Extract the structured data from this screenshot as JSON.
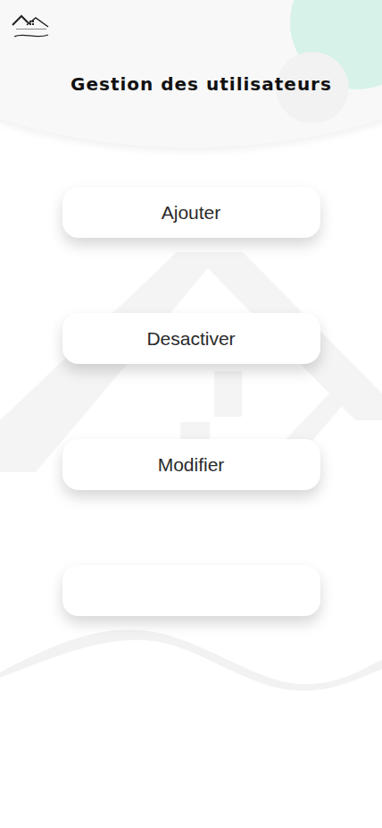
{
  "header": {
    "title": "Gestion des utilisateurs"
  },
  "buttons": [
    {
      "label": "Ajouter"
    },
    {
      "label": "Desactiver"
    },
    {
      "label": "Modifier"
    },
    {
      "label": ""
    }
  ]
}
